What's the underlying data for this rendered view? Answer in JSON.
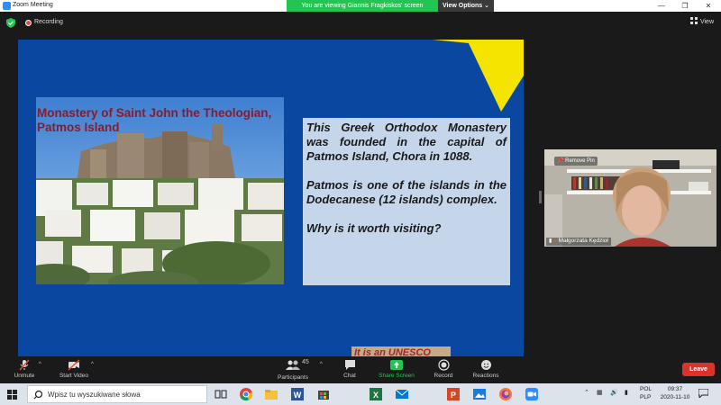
{
  "window": {
    "title": "Zoom Meeting",
    "controls": [
      "minimize",
      "maximize",
      "close"
    ]
  },
  "banner": {
    "viewing_text": "You are viewing Giannis Fragkiskos' screen",
    "view_options_label": "View Options ⌄"
  },
  "status": {
    "recording_label": "Recording",
    "view_label": "View"
  },
  "slide": {
    "photo_title": "Monastery of Saint John the Theologian, Patmos Island",
    "paragraphs": [
      "This Greek Orthodox Monastery was founded in the capital of Patmos Island, Chora in 1088.",
      "Patmos is one of the islands in the Dodecanese (12 islands) complex."
    ],
    "question": "Why is it worth visiting?",
    "partial_text": "It is an UNESCO",
    "colors": {
      "background": "#0a47a0",
      "star": "#f5e400",
      "title": "#8a1c2b",
      "textbox": "#c5d6ea"
    }
  },
  "video": {
    "remove_pin_label": "Remove Pin",
    "participant_name": "Małgorzata Kędzioł"
  },
  "toolbar": {
    "unmute_label": "Unmute",
    "start_video_label": "Start Video",
    "participants_label": "Participants",
    "participants_count": "45",
    "chat_label": "Chat",
    "share_screen_label": "Share Screen",
    "record_label": "Record",
    "reactions_label": "Reactions",
    "leave_label": "Leave",
    "colors": {
      "share": "#23c552",
      "leave": "#d9332a"
    }
  },
  "taskbar": {
    "search_placeholder": "Wpisz tu wyszukiwane słowa",
    "language_top": "POL",
    "language_bottom": "PLP",
    "time": "09:37",
    "date": "2020-11-10",
    "apps": [
      "task-view",
      "chrome",
      "file-explorer",
      "word",
      "store",
      "excel",
      "mail",
      "powerpoint",
      "photos",
      "firefox",
      "zoom"
    ]
  }
}
